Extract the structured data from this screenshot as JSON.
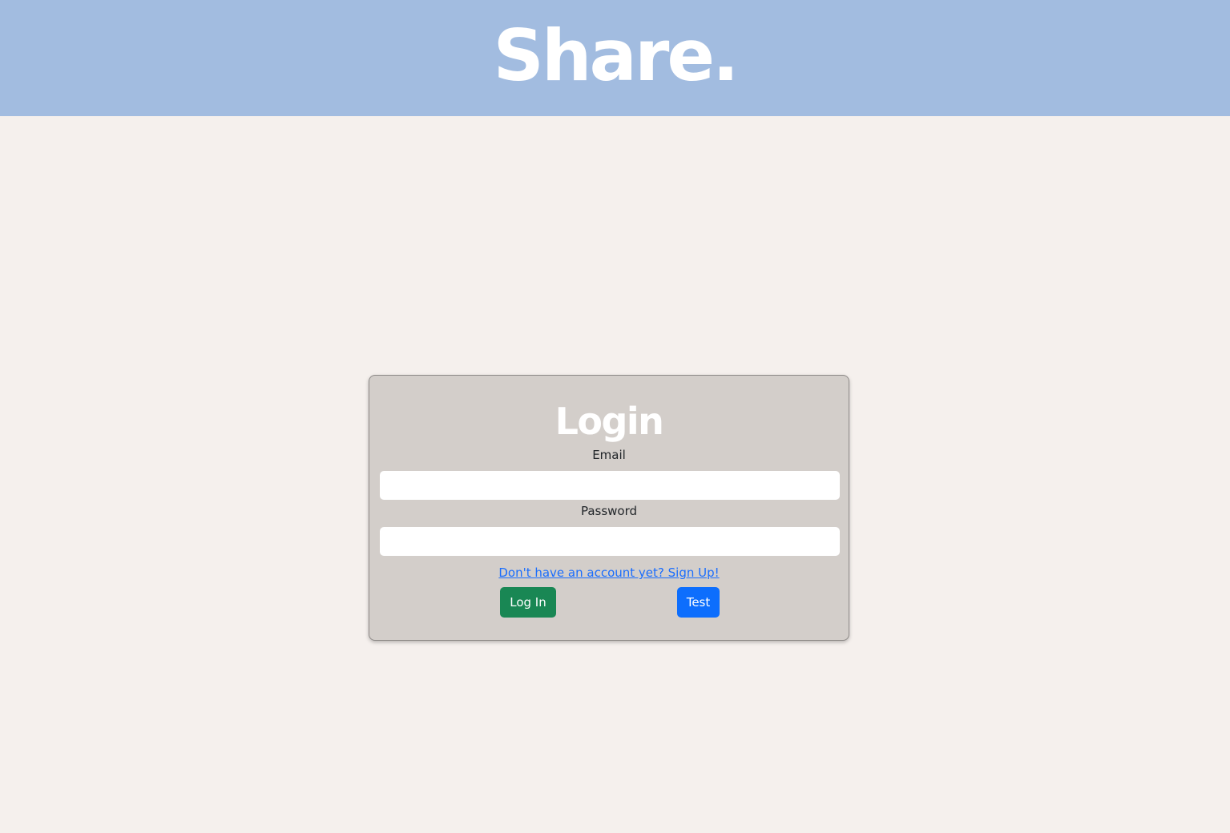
{
  "header": {
    "brand": "Share.",
    "background": "#a2bce0"
  },
  "login_card": {
    "title": "Login",
    "email": {
      "label": "Email",
      "value": "",
      "placeholder": ""
    },
    "password": {
      "label": "Password",
      "value": "",
      "placeholder": ""
    },
    "signup_link": "Don't have an account yet? Sign Up!",
    "login_button": "Log In",
    "test_button": "Test"
  },
  "colors": {
    "page_background": "#f5f0ed",
    "card_background": "#d3ceca",
    "login_button": "#198754",
    "test_button": "#0d6efd",
    "link": "#1a6dfd"
  }
}
